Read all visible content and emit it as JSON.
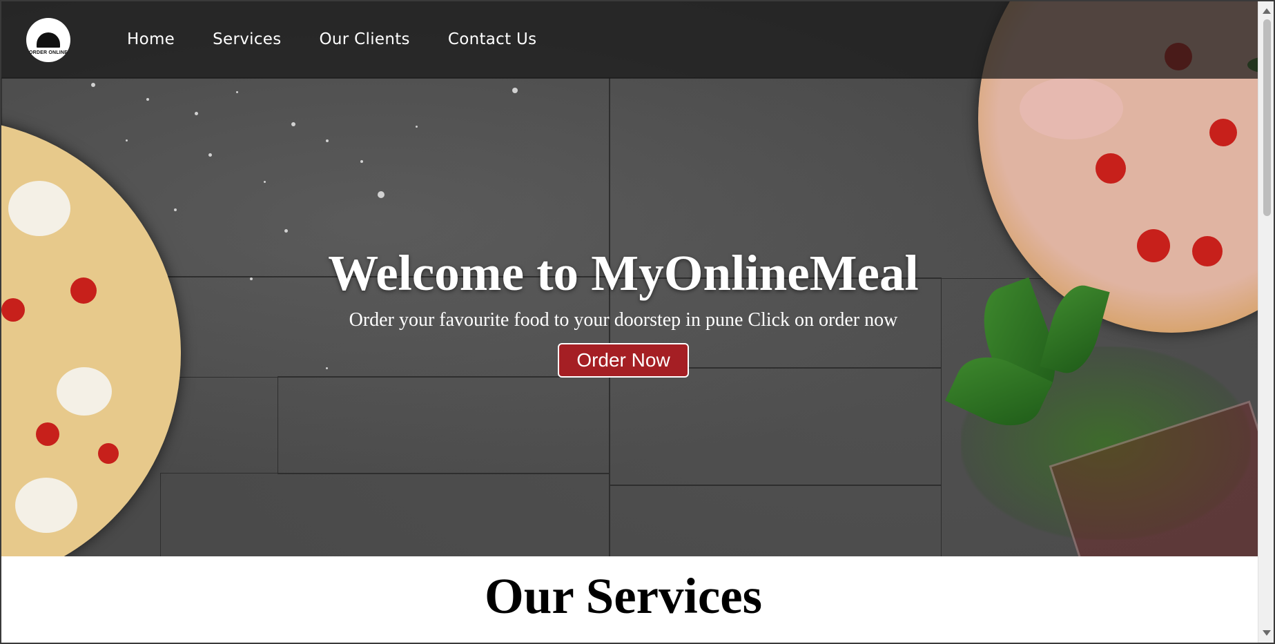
{
  "header": {
    "logo_text": "ORDER ONLINE",
    "nav": [
      {
        "label": "Home"
      },
      {
        "label": "Services"
      },
      {
        "label": "Our Clients"
      },
      {
        "label": "Contact Us"
      }
    ]
  },
  "hero": {
    "title": "Welcome to MyOnlineMeal",
    "subtitle": "Order your favourite food to your doorstep in pune Click on order now",
    "button_label": "Order Now"
  },
  "services": {
    "title": "Our Services"
  },
  "colors": {
    "accent": "#a51f24",
    "header_bg": "#191919",
    "text_light": "#ffffff"
  },
  "icons": {
    "logo": "cloche-logo-icon"
  }
}
